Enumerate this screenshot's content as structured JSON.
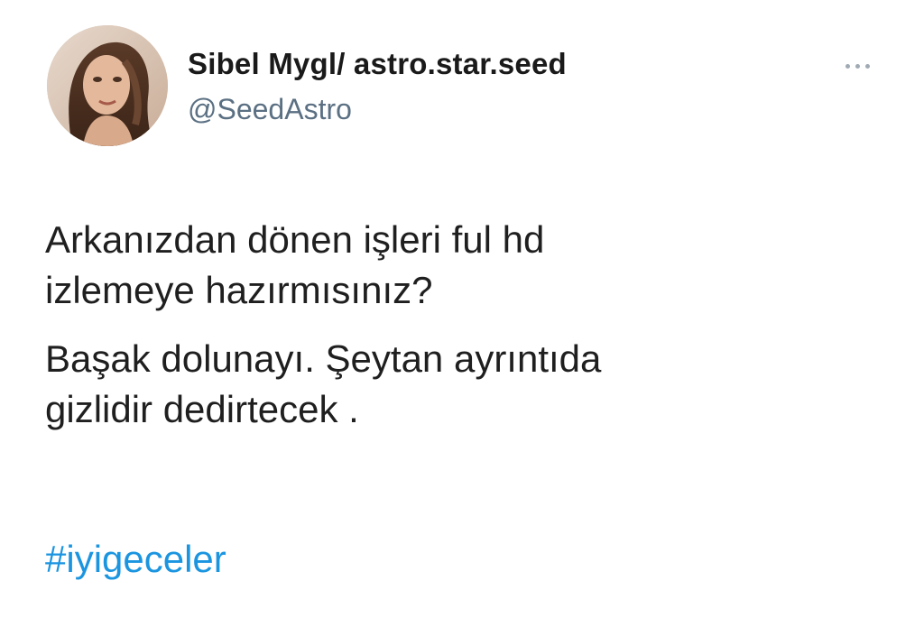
{
  "author": {
    "display_name": "Sibel Mygl/ astro.star.seed",
    "handle": "@SeedAstro",
    "avatar": "profile-photo"
  },
  "tweet": {
    "paragraph_1_line_1": "Arkanızdan dönen işleri ful hd",
    "paragraph_1_line_2": "izlemeye hazırmısınız?",
    "paragraph_2_line_1": "Başak dolunayı. Şeytan ayrıntıda",
    "paragraph_2_line_2": "gizlidir dedirtecek .",
    "hashtag": "#iyigeceler"
  },
  "icons": {
    "more": "more-options-icon"
  },
  "colors": {
    "text": "#1f1f1f",
    "handle": "#5b7083",
    "link": "#1b95e0",
    "background": "#ffffff"
  }
}
